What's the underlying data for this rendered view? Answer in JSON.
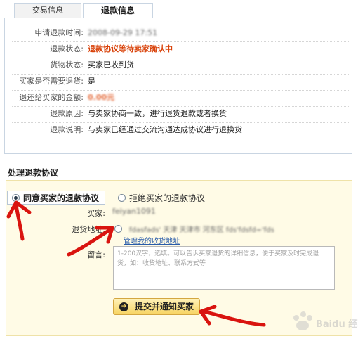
{
  "tabs": [
    {
      "label": "交易信息"
    },
    {
      "label": "退款信息"
    }
  ],
  "refund_info": [
    {
      "label": "申请退款时间:",
      "value": "2008-09-29 17:51"
    },
    {
      "label": "退款状态:",
      "value": "退款协议等待卖家确认中"
    },
    {
      "label": "货物状态:",
      "value": "买家已收到货"
    },
    {
      "label": "买家是否需要退货:",
      "value": "是"
    },
    {
      "label": "退还给买家的金额:",
      "value": "0.00元"
    },
    {
      "label": "退款原因:",
      "value": "与卖家协商一致，进行退货退款或者换货"
    },
    {
      "label": "退款说明:",
      "value": "与卖家已经通过交流沟通达成协议进行退换货"
    }
  ],
  "section_title": "处理退款协议",
  "agreement": {
    "agree_option": "同意买家的退款协议",
    "reject_option": "拒绝买家的退款协议",
    "buyer_label": "买家:",
    "buyer_value": "feiyan1091",
    "address_label": "退货地址:",
    "address_value": "fdasfads' 天津 天津市 河东区 fds'fdsfd='fds",
    "manage_address_link": "管理我的收货地址",
    "message_label": "留言:",
    "message_placeholder": "1-200汉字，选填。可以告诉买家退货的详细信息，便于买家及时完成退货，如：收货地址、联系方式等",
    "submit_button": "提交并通知买家"
  },
  "watermark_text": "Baidu 经验",
  "colors": {
    "status_red": "#d9430b",
    "panel_yellow": "#fffbe6",
    "button_gold": "#f7d463",
    "annotation_red": "#d9140f"
  }
}
